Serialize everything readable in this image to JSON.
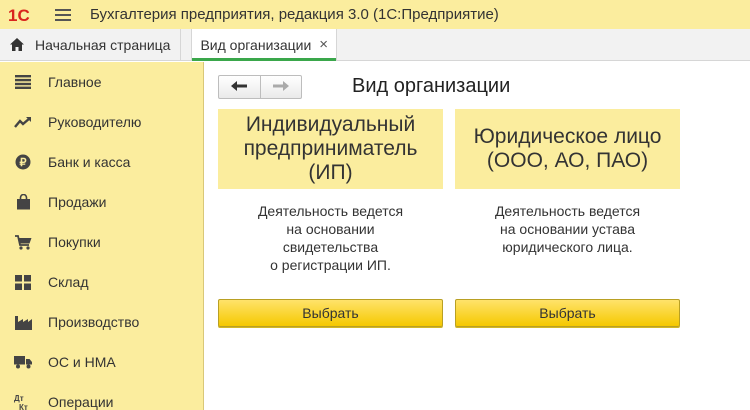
{
  "window": {
    "logo_text": "1С",
    "title": "Бухгалтерия предприятия, редакция 3.0  (1С:Предприятие)"
  },
  "tabs": {
    "home_label": "Начальная страница",
    "active_label": "Вид организации",
    "close_symbol": "×"
  },
  "sidebar": {
    "items": [
      {
        "label": "Главное",
        "icon": "list-icon"
      },
      {
        "label": "Руководителю",
        "icon": "trend-icon"
      },
      {
        "label": "Банк и касса",
        "icon": "coin-icon"
      },
      {
        "label": "Продажи",
        "icon": "bag-icon"
      },
      {
        "label": "Покупки",
        "icon": "cart-icon"
      },
      {
        "label": "Склад",
        "icon": "warehouse-icon"
      },
      {
        "label": "Производство",
        "icon": "factory-icon"
      },
      {
        "label": "ОС и НМА",
        "icon": "truck-icon"
      },
      {
        "label": "Операции",
        "icon": "dt-kt-icon"
      }
    ],
    "dt_kt_text": {
      "dt": "Дт",
      "kt": "Кт"
    }
  },
  "form": {
    "title": "Вид организации",
    "cards": [
      {
        "header": "Индивидуальный предприниматель (ИП)",
        "description": "Деятельность ведется\nна основании\nсвидетельства\nо регистрации ИП.",
        "button_label": "Выбрать"
      },
      {
        "header": "Юридическое лицо (ООО, АО, ПАО)",
        "description": "Деятельность ведется\nна основании устава\nюридического лица.",
        "button_label": "Выбрать"
      }
    ]
  },
  "colors": {
    "panel_yellow": "#fbed9e",
    "button_yellow": "#f5c800",
    "logo_red": "#d9251d",
    "active_tab_accent": "#3aa74b"
  }
}
